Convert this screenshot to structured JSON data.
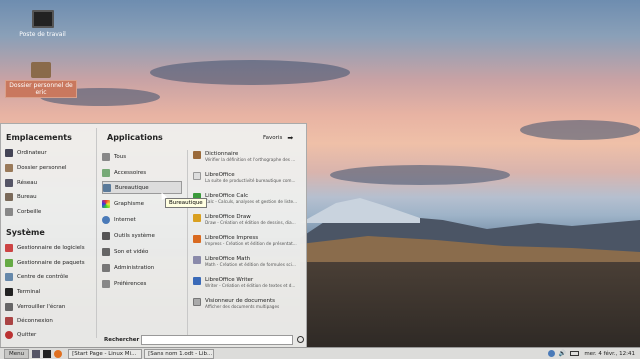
{
  "desktop": {
    "icons": [
      {
        "label": "Poste de travail",
        "icon": "computer-icon"
      },
      {
        "label": "Dossier personnel de eric",
        "icon": "home-folder-icon"
      }
    ]
  },
  "menu": {
    "places": {
      "heading": "Emplacements",
      "items": [
        "Ordinateur",
        "Dossier personnel",
        "Réseau",
        "Bureau",
        "Corbeille"
      ]
    },
    "system": {
      "heading": "Système",
      "items": [
        "Gestionnaire de logiciels",
        "Gestionnaire de paquets",
        "Centre de contrôle",
        "Terminal",
        "Verrouiller l'écran",
        "Déconnexion",
        "Quitter"
      ]
    },
    "apps": {
      "heading": "Applications",
      "favorites": "Favoris"
    },
    "categories": [
      "Tous",
      "Accessoires",
      "Bureautique",
      "Graphisme",
      "Internet",
      "Outils système",
      "Son et vidéo",
      "Administration",
      "Préférences"
    ],
    "selected_category": "Bureautique",
    "tooltip": "Bureautique",
    "applications": [
      {
        "name": "Dictionnaire",
        "desc": "Vérifier la définition et l'orthographe des ..."
      },
      {
        "name": "LibreOffice",
        "desc": "La suite de productivité bureautique com..."
      },
      {
        "name": "LibreOffice Calc",
        "desc": "Calc - Calculs, analyses et gestion de liste..."
      },
      {
        "name": "LibreOffice Draw",
        "desc": "Draw - Création et édition de dessins, dia..."
      },
      {
        "name": "LibreOffice Impress",
        "desc": "Impress - Création et édition de présentat..."
      },
      {
        "name": "LibreOffice Math",
        "desc": "Math - Création et édition de formules sci..."
      },
      {
        "name": "LibreOffice Writer",
        "desc": "Writer - Création et édition de textes et d..."
      },
      {
        "name": "Visionneur de documents",
        "desc": "Afficher des documents multipages"
      }
    ],
    "search_label": "Rechercher :",
    "search_value": ""
  },
  "taskbar": {
    "menu_label": "Menu",
    "tasks": [
      "[Start Page - Linux Mi...",
      "[Sans nom 1.odt - Lib..."
    ],
    "clock": "mer. 4 févr., 12:41"
  }
}
